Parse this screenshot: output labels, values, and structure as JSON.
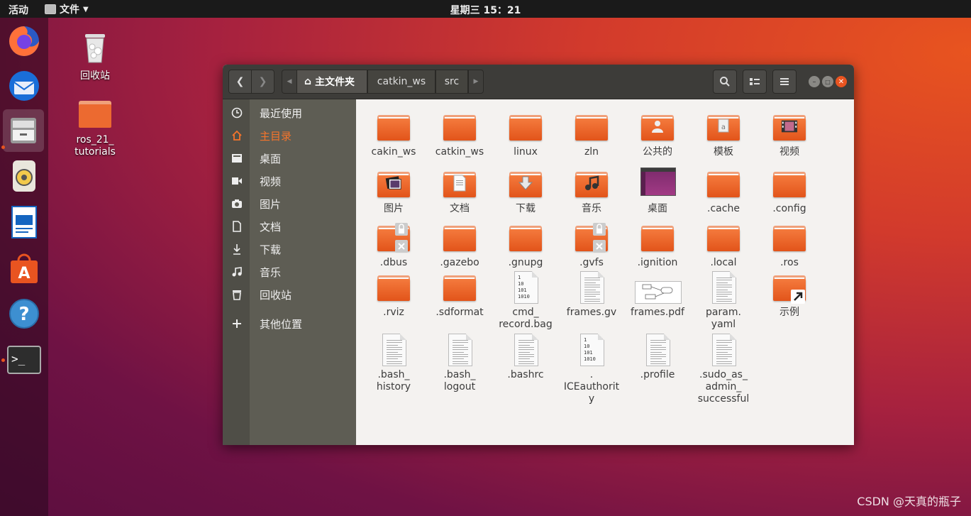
{
  "topbar": {
    "activities": "活动",
    "app_name": "文件",
    "clock": "星期三 15：21"
  },
  "dock": [
    "firefox",
    "thunderbird",
    "files",
    "rhythmbox",
    "libreoffice-writer",
    "software-center",
    "help",
    "terminal"
  ],
  "desktop": [
    {
      "label": "回收站",
      "icon": "trash-icon"
    },
    {
      "label": "ros_21_\ntutorials",
      "icon": "folder-icon"
    }
  ],
  "header": {
    "breadcrumbs": [
      "主文件夹",
      "catkin_ws",
      "src"
    ],
    "buttons": {
      "back": "back",
      "forward": "forward",
      "search": "search",
      "view": "view",
      "menu": "menu"
    }
  },
  "sidebar": {
    "items": [
      {
        "label": "最近使用",
        "icon": "clock-icon"
      },
      {
        "label": "主目录",
        "icon": "home-icon",
        "selected": true
      },
      {
        "label": "桌面",
        "icon": "desktop-icon"
      },
      {
        "label": "视频",
        "icon": "video-icon"
      },
      {
        "label": "图片",
        "icon": "camera-icon"
      },
      {
        "label": "文档",
        "icon": "document-icon"
      },
      {
        "label": "下载",
        "icon": "download-icon"
      },
      {
        "label": "音乐",
        "icon": "music-icon"
      },
      {
        "label": "回收站",
        "icon": "trash-icon"
      },
      {
        "label": "其他位置",
        "icon": "plus-icon"
      }
    ]
  },
  "files": [
    {
      "label": "cakin_ws",
      "type": "folder"
    },
    {
      "label": "catkin_ws",
      "type": "folder"
    },
    {
      "label": "linux",
      "type": "folder"
    },
    {
      "label": "zln",
      "type": "folder"
    },
    {
      "label": "公共的",
      "type": "folder",
      "overlay": "user"
    },
    {
      "label": "模板",
      "type": "folder",
      "overlay": "template"
    },
    {
      "label": "视频",
      "type": "folder",
      "overlay": "video"
    },
    {
      "label": "图片",
      "type": "folder",
      "overlay": "picture"
    },
    {
      "label": "文档",
      "type": "folder",
      "overlay": "document"
    },
    {
      "label": "下载",
      "type": "folder",
      "overlay": "download"
    },
    {
      "label": "音乐",
      "type": "folder",
      "overlay": "music"
    },
    {
      "label": "桌面",
      "type": "desktop"
    },
    {
      "label": ".cache",
      "type": "folder"
    },
    {
      "label": ".config",
      "type": "folder"
    },
    {
      "label": ".dbus",
      "type": "folder",
      "overlay": "locked"
    },
    {
      "label": ".gazebo",
      "type": "folder"
    },
    {
      "label": ".gnupg",
      "type": "folder"
    },
    {
      "label": ".gvfs",
      "type": "folder",
      "overlay": "locked"
    },
    {
      "label": ".ignition",
      "type": "folder"
    },
    {
      "label": ".local",
      "type": "folder"
    },
    {
      "label": ".ros",
      "type": "folder"
    },
    {
      "label": ".rviz",
      "type": "folder"
    },
    {
      "label": ".sdformat",
      "type": "folder"
    },
    {
      "label": "cmd_\nrecord.bag",
      "type": "binary"
    },
    {
      "label": "frames.gv",
      "type": "text"
    },
    {
      "label": "frames.pdf",
      "type": "pdf"
    },
    {
      "label": "param.\nyaml",
      "type": "text"
    },
    {
      "label": "示例",
      "type": "folder",
      "overlay": "link"
    },
    {
      "label": ".bash_\nhistory",
      "type": "text"
    },
    {
      "label": ".bash_\nlogout",
      "type": "text"
    },
    {
      "label": ".bashrc",
      "type": "text"
    },
    {
      "label": ".\nICEauthorit\ny",
      "type": "binary"
    },
    {
      "label": ".profile",
      "type": "text"
    },
    {
      "label": ".sudo_as_\nadmin_\nsuccessful",
      "type": "text"
    }
  ],
  "watermark": "CSDN @天真的瓶子"
}
